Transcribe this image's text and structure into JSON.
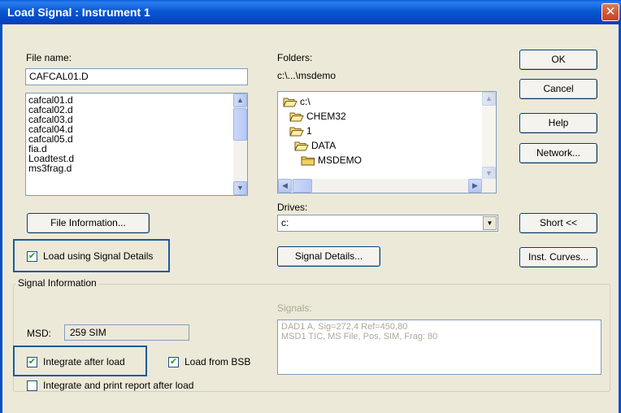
{
  "window": {
    "title": "Load Signal : Instrument 1",
    "close_glyph": "✕"
  },
  "file": {
    "label": "File name:",
    "value": "CAFCAL01.D",
    "list": [
      "cafcal01.d",
      "cafcal02.d",
      "cafcal03.d",
      "cafcal04.d",
      "cafcal05.d",
      "fia.d",
      "Loadtest.d",
      "ms3frag.d"
    ]
  },
  "folders": {
    "label": "Folders:",
    "path": "c:\\...\\msdemo",
    "tree": [
      "c:\\",
      "CHEM32",
      "1",
      "DATA",
      "MSDEMO"
    ]
  },
  "drives": {
    "label": "Drives:",
    "value": "c:"
  },
  "buttons": {
    "ok": "OK",
    "cancel": "Cancel",
    "help": "Help",
    "network": "Network...",
    "file_information": "File Information...",
    "signal_details": "Signal Details...",
    "short": "Short <<",
    "inst_curves": "Inst. Curves..."
  },
  "options": {
    "load_signal_details": {
      "label": "Load using Signal Details",
      "checked": true
    },
    "integrate_after_load": {
      "label": "Integrate after load",
      "checked": true
    },
    "load_from_bsb": {
      "label": "Load from BSB",
      "checked": true
    },
    "integrate_print": {
      "label": "Integrate and print report after load",
      "checked": false
    }
  },
  "signal_info": {
    "group_title": "Signal Information",
    "msd_label": "MSD:",
    "msd_value": "259 SIM",
    "signals_label": "Signals:",
    "signals": [
      "DAD1 A, Sig=272,4 Ref=450,80",
      "MSD1 TIC, MS File, Pos, SIM, Frag: 80"
    ]
  },
  "icons": {
    "checkmark": "✔",
    "folder": "folder-icon",
    "folder_open": "folder-open-icon",
    "scroll_up": "▲",
    "scroll_down": "▼",
    "scroll_left": "◀",
    "scroll_right": "▶",
    "combo_arrow": "▼"
  },
  "colors": {
    "title_bar": "#0a58d2",
    "dialog_bg": "#ece9d8",
    "highlight_border": "#1d5a9e"
  }
}
